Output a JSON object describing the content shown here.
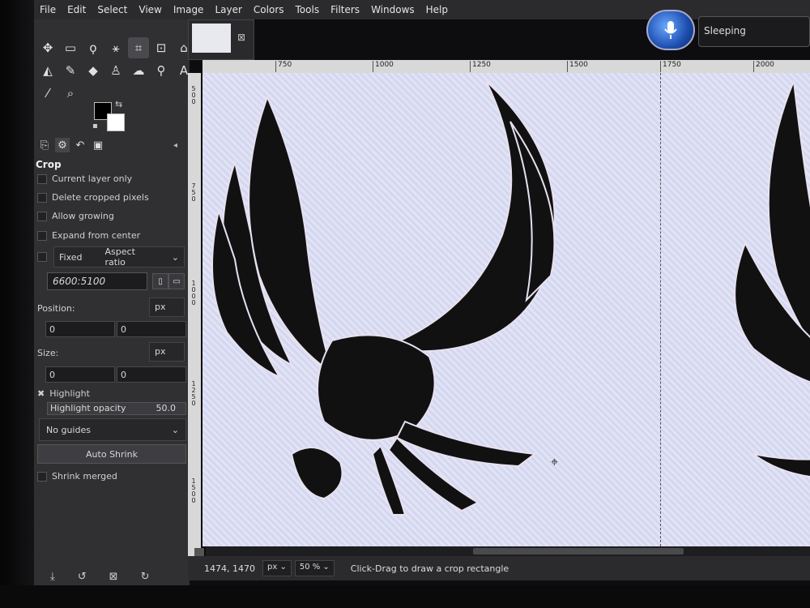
{
  "menubar": {
    "items": [
      "File",
      "Edit",
      "Select",
      "View",
      "Image",
      "Layer",
      "Colors",
      "Tools",
      "Filters",
      "Windows",
      "Help"
    ]
  },
  "speech": {
    "status": "Sleeping"
  },
  "tool_options": {
    "title": "Crop",
    "current_layer_only": "Current layer only",
    "delete_cropped_pixels": "Delete cropped pixels",
    "allow_growing": "Allow growing",
    "expand_from_center": "Expand from center",
    "fixed_label": "Fixed",
    "fixed_mode": "Aspect ratio",
    "ratio_value": "6600:5100",
    "position_label": "Position:",
    "position_unit": "px",
    "position_x": "0",
    "position_y": "0",
    "size_label": "Size:",
    "size_unit": "px",
    "size_w": "0",
    "size_h": "0",
    "highlight_label": "Highlight",
    "highlight_opacity_label": "Highlight opacity",
    "highlight_opacity_value": "50.0",
    "guides": "No guides",
    "auto_shrink": "Auto Shrink",
    "shrink_merged": "Shrink merged"
  },
  "rulers": {
    "top_ticks": [
      "750",
      "1000",
      "1250",
      "1500",
      "1750",
      "2000"
    ],
    "left_ticks": [
      "5\n0\n0",
      "7\n5\n0",
      "1\n0\n0\n0",
      "1\n2\n5\n0",
      "1\n5\n0\n0"
    ]
  },
  "status_bar": {
    "coords": "1474, 1470",
    "unit": "px",
    "zoom": "50 %",
    "message": "Click-Drag to draw a crop rectangle"
  },
  "colors": {
    "foreground": "#000000",
    "background": "#ffffff"
  }
}
